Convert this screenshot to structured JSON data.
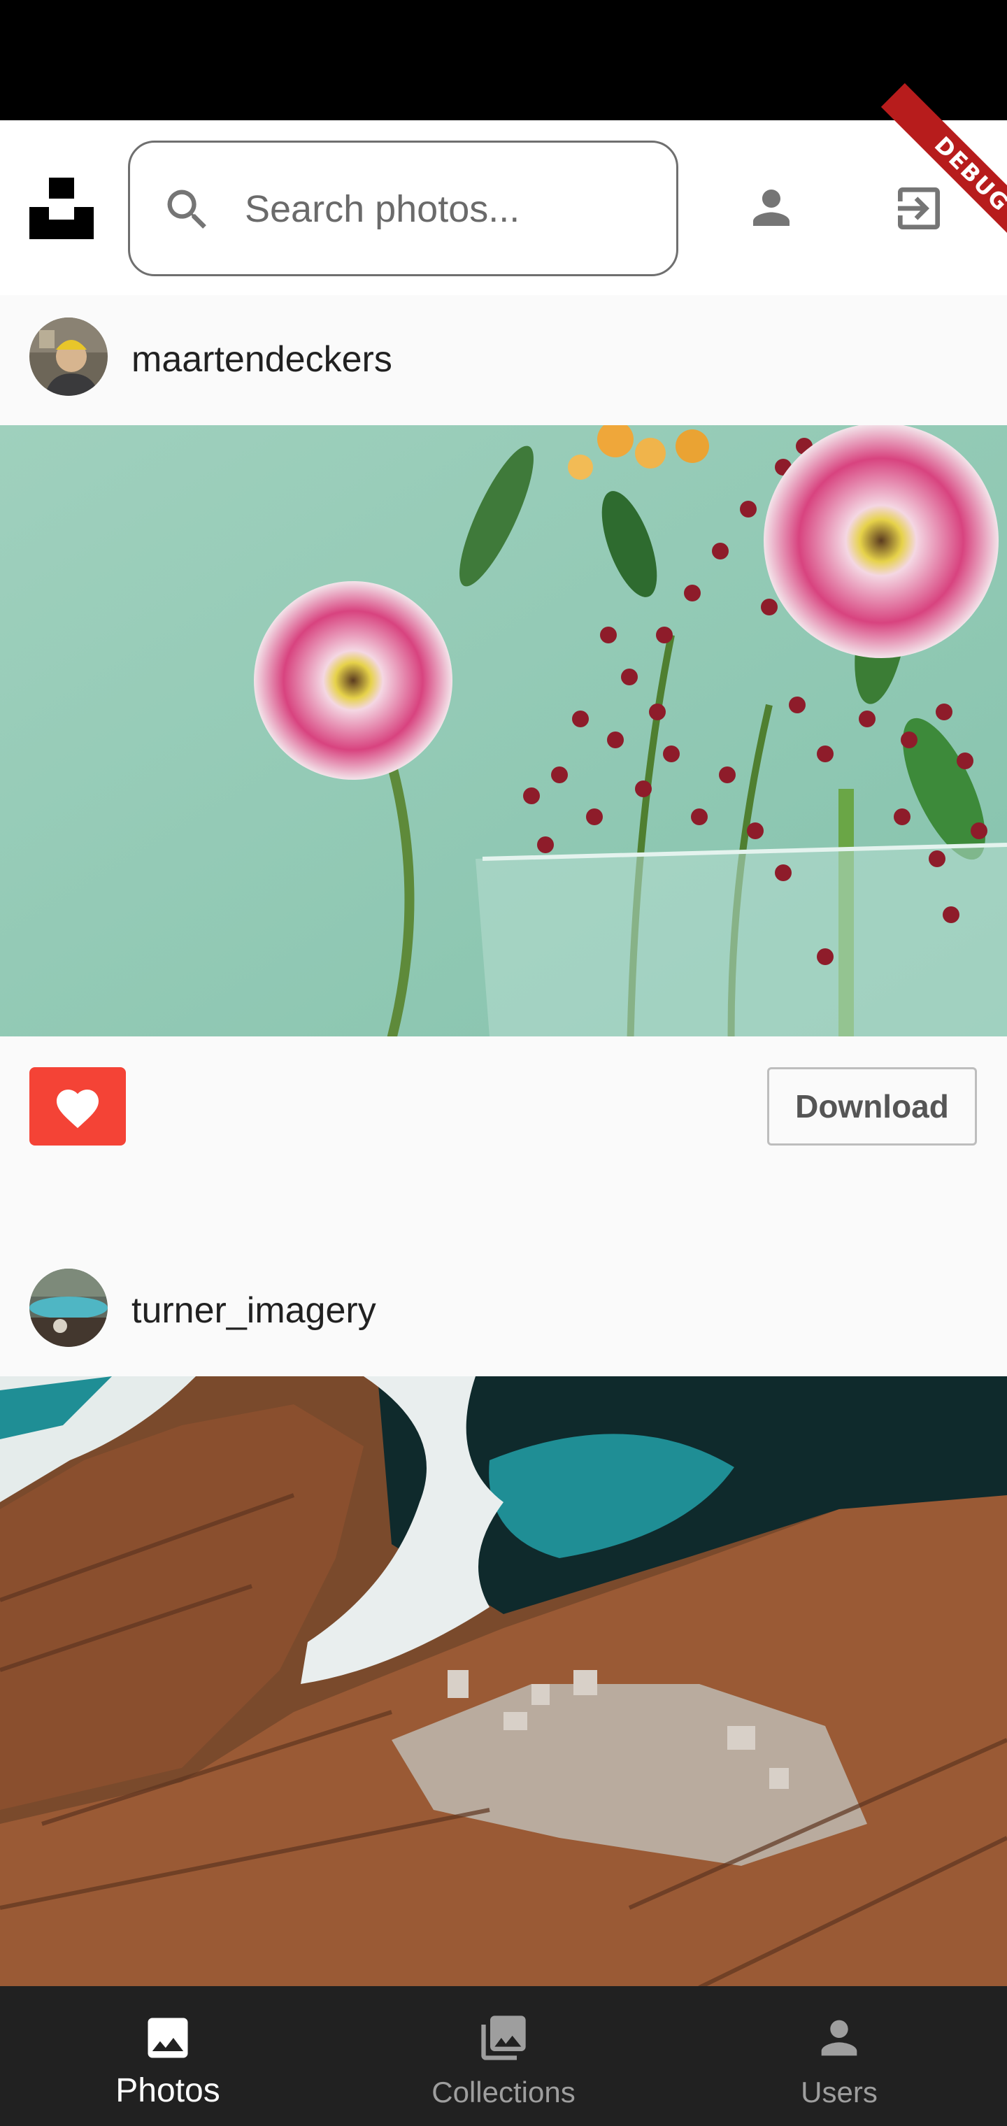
{
  "app": {
    "debug_banner": "DEBUG",
    "icons": {
      "logo": "unsplash-logo",
      "search": "search-icon",
      "profile": "person-icon",
      "logout": "logout-icon"
    }
  },
  "search": {
    "placeholder": "Search photos..."
  },
  "posts": [
    {
      "username": "maartendeckers",
      "liked": true,
      "download_label": "Download",
      "like_color": "#f44336"
    },
    {
      "username": "turner_imagery"
    }
  ],
  "bottom_nav": {
    "items": [
      {
        "label": "Photos",
        "icon": "photo-icon",
        "active": true
      },
      {
        "label": "Collections",
        "icon": "collections-icon",
        "active": false
      },
      {
        "label": "Users",
        "icon": "person-icon",
        "active": false
      }
    ]
  },
  "colors": {
    "status_bar": "#000000",
    "app_bar": "#ffffff",
    "nav_bg": "#212121",
    "like": "#f44336"
  }
}
